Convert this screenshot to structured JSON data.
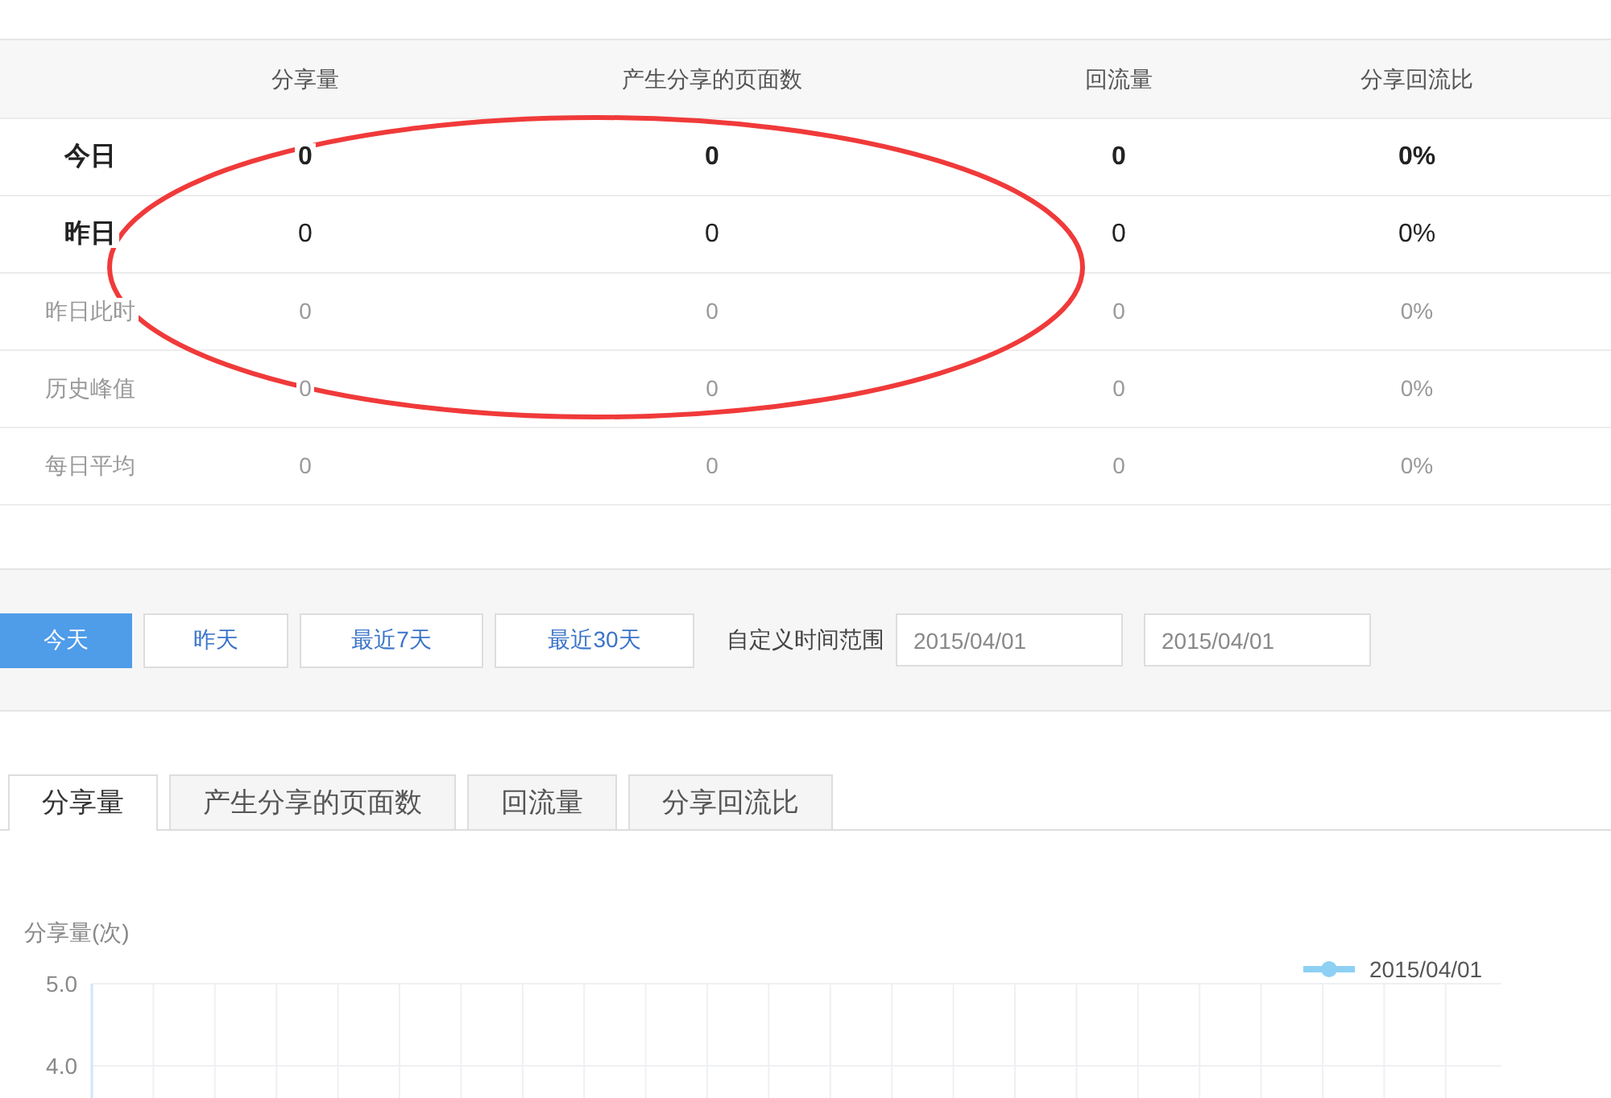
{
  "table": {
    "columns": [
      "分享量",
      "产生分享的页面数",
      "回流量",
      "分享回流比"
    ],
    "rows": [
      {
        "label": "今日",
        "kind": "today",
        "cells": [
          "0",
          "0",
          "0",
          "0%"
        ]
      },
      {
        "label": "昨日",
        "kind": "yesterday",
        "cells": [
          "0",
          "0",
          "0",
          "0%"
        ]
      },
      {
        "label": "昨日此时",
        "kind": "reference",
        "cells": [
          "0",
          "0",
          "0",
          "0%"
        ]
      },
      {
        "label": "历史峰值",
        "kind": "reference",
        "cells": [
          "0",
          "0",
          "0",
          "0%"
        ]
      },
      {
        "label": "每日平均",
        "kind": "reference",
        "cells": [
          "0",
          "0",
          "0",
          "0%"
        ]
      }
    ]
  },
  "range_buttons": [
    {
      "label": "今天",
      "selected": true
    },
    {
      "label": "昨天",
      "selected": false
    },
    {
      "label": "最近7天",
      "selected": false
    },
    {
      "label": "最近30天",
      "selected": false
    }
  ],
  "custom_range": {
    "label": "自定义时间范围",
    "start": "2015/04/01",
    "end": "2015/04/01"
  },
  "tabs": [
    {
      "label": "分享量",
      "selected": true
    },
    {
      "label": "产生分享的页面数",
      "selected": false
    },
    {
      "label": "回流量",
      "selected": false
    },
    {
      "label": "分享回流比",
      "selected": false
    }
  ],
  "chart": {
    "ylabel": "分享量(次)",
    "yticks": [
      "5.0",
      "4.0"
    ],
    "legend": [
      {
        "label": "2015/04/01",
        "color": "#8dd0f3"
      }
    ]
  },
  "annotation": {
    "color": "#f03a3a"
  }
}
